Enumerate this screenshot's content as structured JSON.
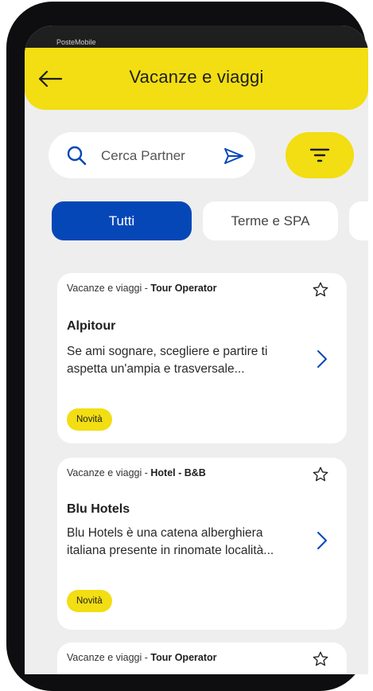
{
  "statusbar": {
    "carrier": "PosteMobile"
  },
  "header": {
    "title": "Vacanze e viaggi",
    "back_icon": "back-arrow-icon"
  },
  "search": {
    "placeholder": "Cerca Partner"
  },
  "filters": {
    "chips": [
      {
        "label": "Tutti",
        "active": true
      },
      {
        "label": "Terme e SPA",
        "active": false
      }
    ]
  },
  "cards": [
    {
      "category": "Vacanze e viaggi - ",
      "subcategory": "Tour Operator",
      "name": "Alpitour",
      "description": "Se ami sognare, scegliere e partire ti aspetta un'ampia e trasversale...",
      "badge": "Novità"
    },
    {
      "category": "Vacanze e viaggi - ",
      "subcategory": "Hotel - B&B",
      "name": "Blu Hotels",
      "description": "Blu Hotels è una catena alberghiera italiana presente in rinomate località...",
      "badge": "Novità"
    },
    {
      "category": "Vacanze e viaggi - ",
      "subcategory": "Tour Operator"
    }
  ],
  "colors": {
    "accent_yellow": "#f2de12",
    "primary_blue": "#0647b8",
    "background": "#eeeeee"
  }
}
